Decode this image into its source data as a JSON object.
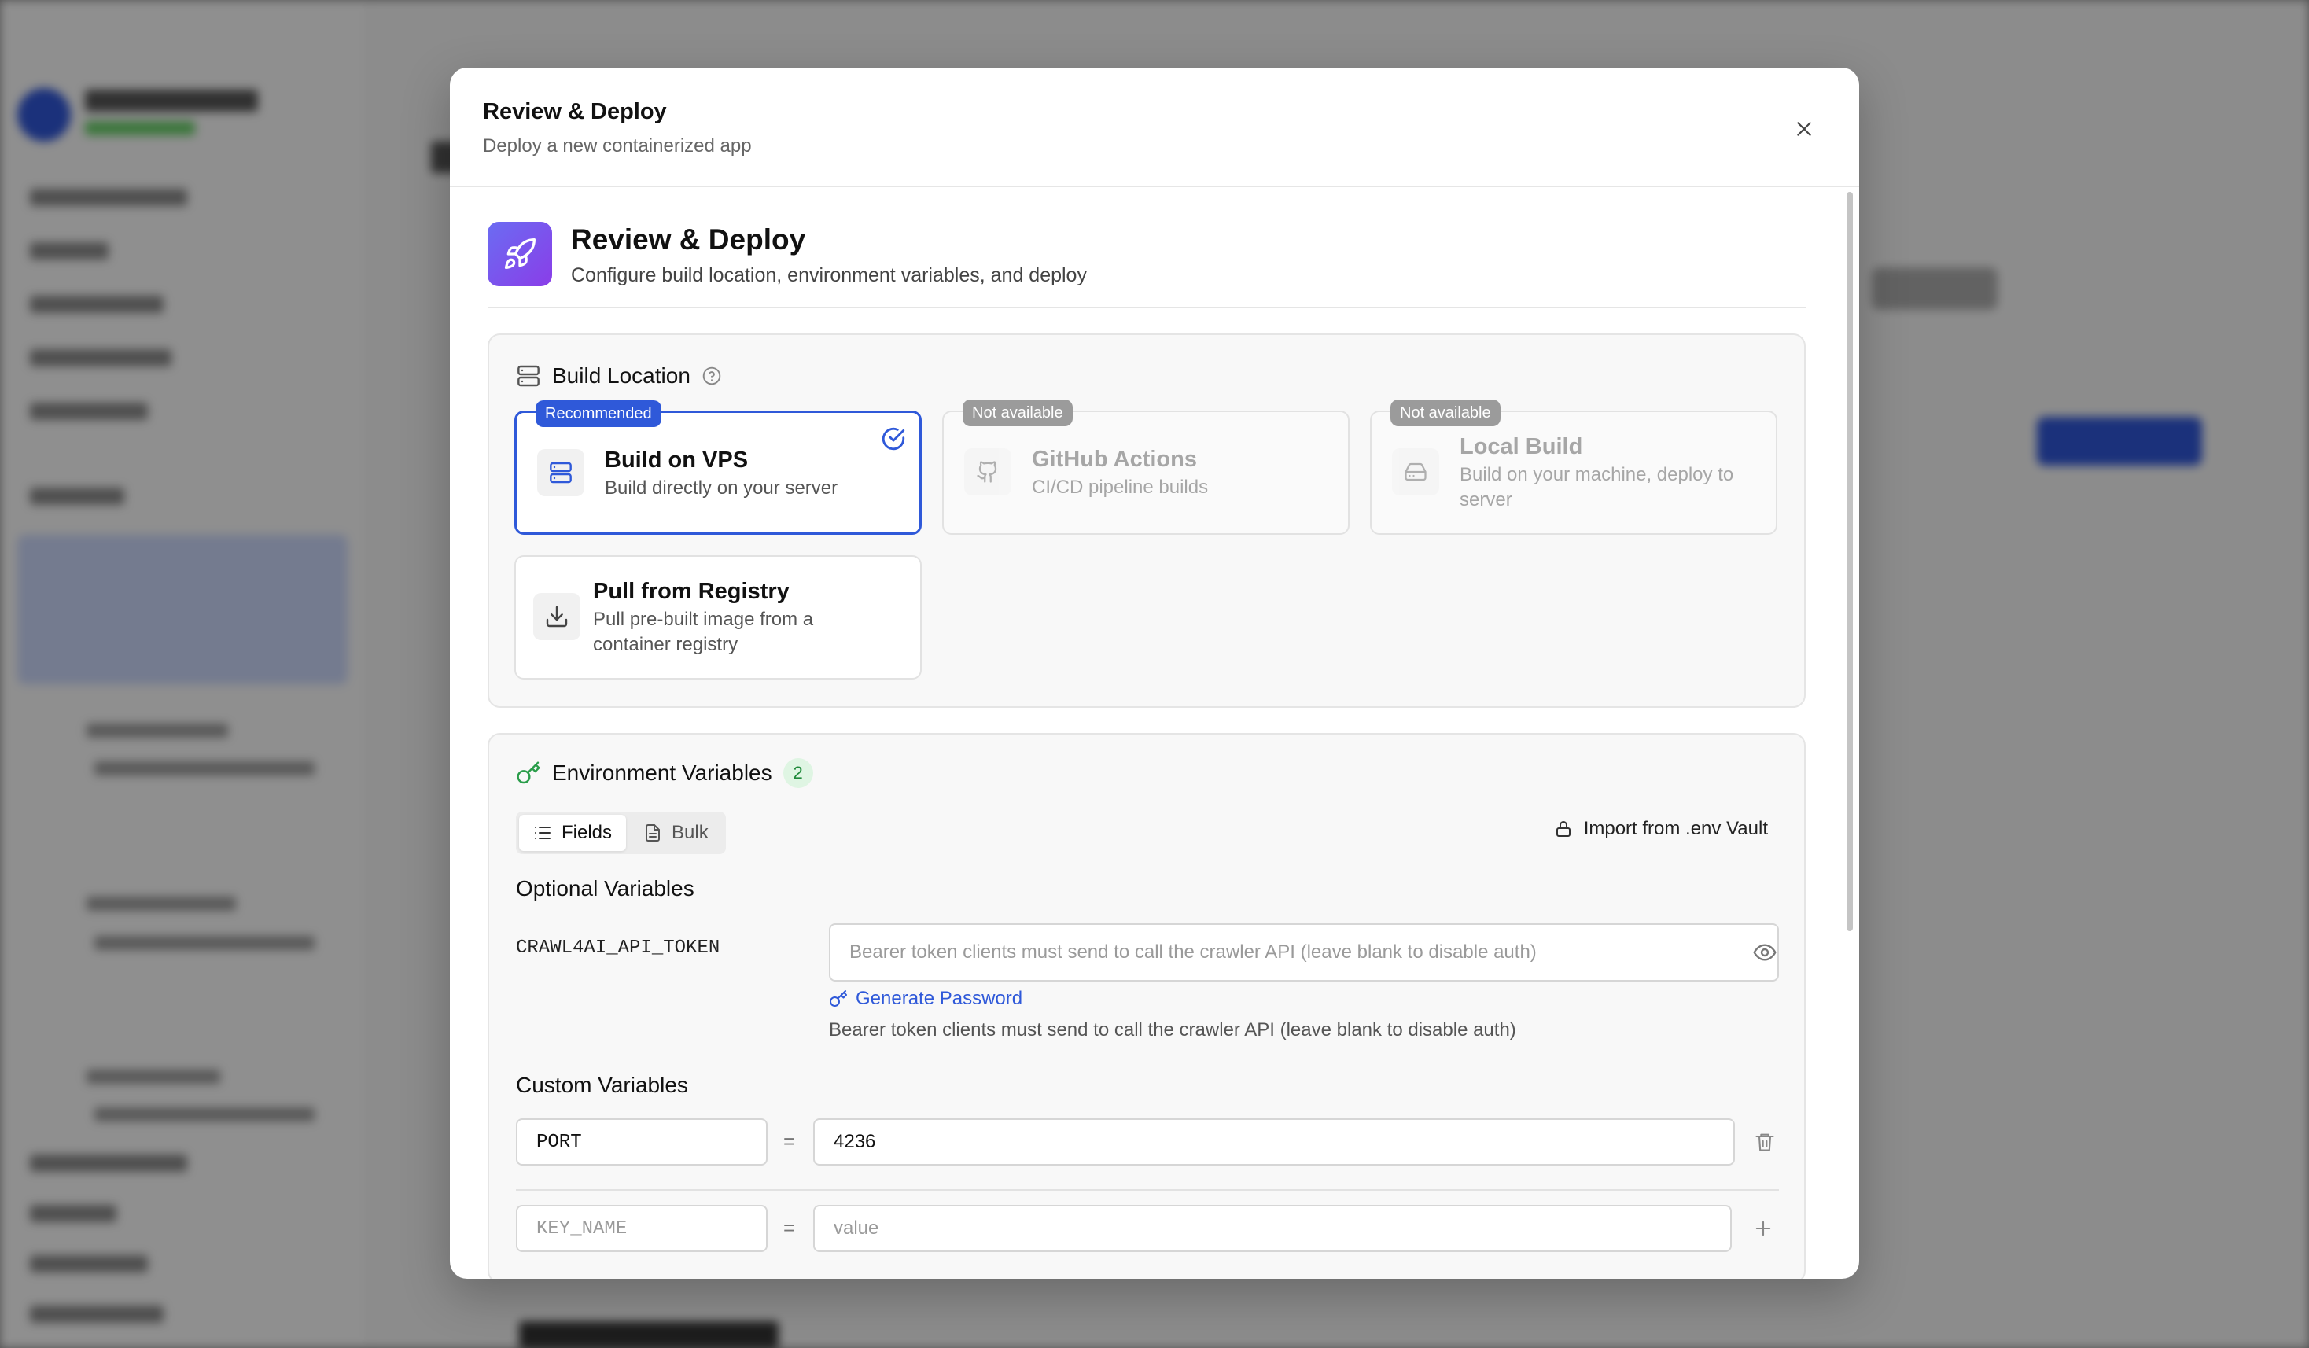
{
  "modal": {
    "title": "Review & Deploy",
    "subtitle": "Deploy a new containerized app"
  },
  "hero": {
    "icon": "rocket-icon",
    "title": "Review & Deploy",
    "subtitle": "Configure build location, environment variables, and deploy"
  },
  "build_location": {
    "title": "Build Location",
    "options": [
      {
        "badge": "Recommended",
        "title": "Build on VPS",
        "description": "Build directly on your server",
        "icon": "server-icon",
        "selected": true,
        "available": true
      },
      {
        "badge": "Not available",
        "title": "GitHub Actions",
        "description": "CI/CD pipeline builds",
        "icon": "github-icon",
        "selected": false,
        "available": false
      },
      {
        "badge": "Not available",
        "title": "Local Build",
        "description": "Build on your machine, deploy to server",
        "icon": "hard-drive-icon",
        "selected": false,
        "available": false
      },
      {
        "badge": "",
        "title": "Pull from Registry",
        "description": "Pull pre-built image from a container registry",
        "icon": "download-icon",
        "selected": false,
        "available": true
      }
    ]
  },
  "env": {
    "title": "Environment Variables",
    "count": "2",
    "tabs": [
      {
        "label": "Fields",
        "active": true
      },
      {
        "label": "Bulk",
        "active": false
      }
    ],
    "import_label": "Import from .env Vault",
    "optional_title": "Optional Variables",
    "optional": [
      {
        "key": "CRAWL4AI_API_TOKEN",
        "value": "",
        "placeholder": "Bearer token clients must send to call the crawler API (leave blank to disable auth)",
        "generate_label": "Generate Password",
        "hint": "Bearer token clients must send to call the crawler API (leave blank to disable auth)"
      }
    ],
    "custom_title": "Custom Variables",
    "custom": [
      {
        "key": "PORT",
        "value": "4236"
      }
    ],
    "new_row": {
      "key_placeholder": "KEY_NAME",
      "value_placeholder": "value"
    },
    "equals": "="
  },
  "colors": {
    "accent": "#2f59d9",
    "hero_gradient_start": "#6b6cf2",
    "hero_gradient_end": "#8a3de8",
    "success": "#1f8a3a"
  }
}
